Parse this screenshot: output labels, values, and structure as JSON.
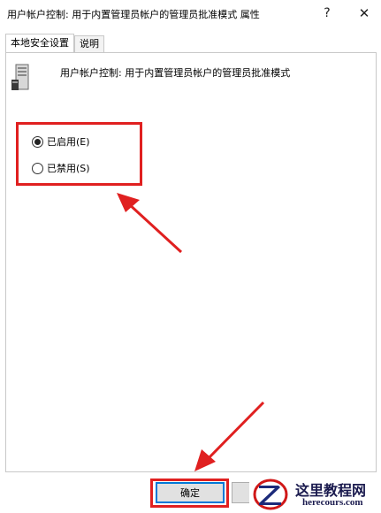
{
  "window": {
    "title": "用户帐户控制: 用于内置管理员帐户的管理员批准模式 属性",
    "help_glyph": "?",
    "close_glyph": "✕"
  },
  "tabs": [
    {
      "label": "本地安全设置",
      "active": true
    },
    {
      "label": "说明",
      "active": false
    }
  ],
  "policy": {
    "icon": "server-policy-icon",
    "name": "用户帐户控制: 用于内置管理员帐户的管理员批准模式"
  },
  "options": [
    {
      "label": "已启用(E)",
      "selected": true
    },
    {
      "label": "已禁用(S)",
      "selected": false
    }
  ],
  "buttons": {
    "ok": "确定",
    "cancel": ""
  },
  "annotation": {
    "highlight_color": "#e02020"
  },
  "watermark": {
    "text_cn": "这里教程网",
    "text_en": "herecours.com"
  }
}
